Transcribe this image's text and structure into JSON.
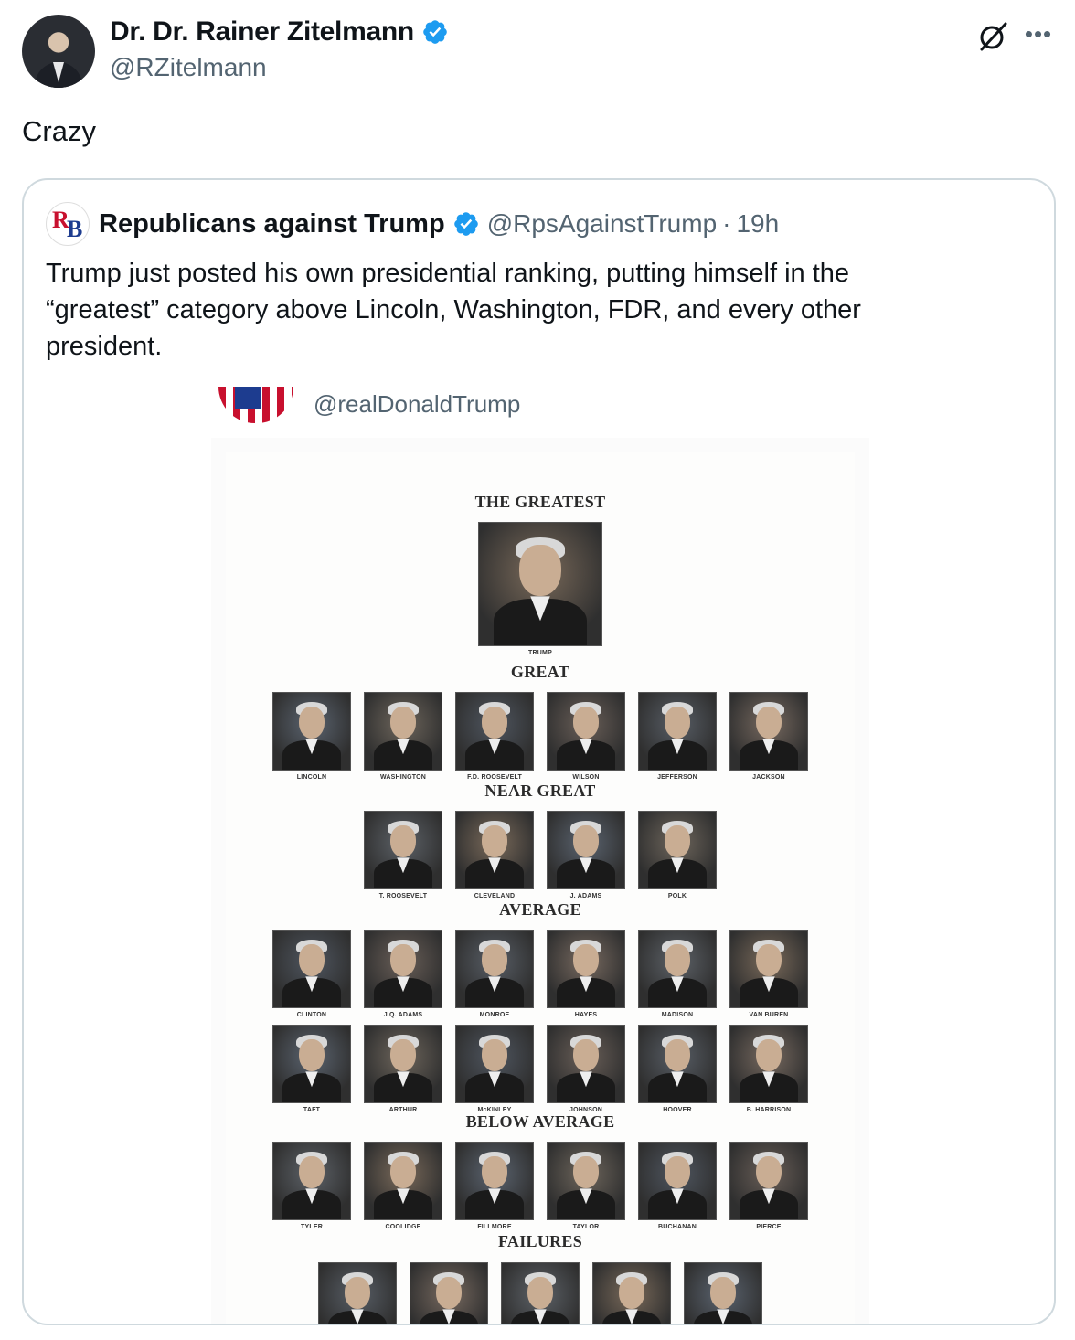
{
  "author": {
    "name": "Dr. Dr. Rainer Zitelmann",
    "handle": "@RZitelmann"
  },
  "tweet": {
    "text": "Crazy"
  },
  "quote": {
    "name": "Republicans against Trump",
    "handle": "@RpsAgainstTrump",
    "separator": "·",
    "time": "19h",
    "text": "Trump just posted his own presidential ranking, putting himself in the “greatest” category above Lincoln, Washington, FDR, and every other president."
  },
  "media": {
    "handle": "@realDonaldTrump",
    "sections": [
      {
        "title": "THE GREATEST",
        "rows": [
          [
            "TRUMP"
          ]
        ]
      },
      {
        "title": "GREAT",
        "rows": [
          [
            "LINCOLN",
            "WASHINGTON",
            "F.D. ROOSEVELT",
            "WILSON",
            "JEFFERSON",
            "JACKSON"
          ]
        ]
      },
      {
        "title": "NEAR GREAT",
        "rows": [
          [
            "T. ROOSEVELT",
            "CLEVELAND",
            "J. ADAMS",
            "POLK"
          ]
        ]
      },
      {
        "title": "AVERAGE",
        "rows": [
          [
            "CLINTON",
            "J.Q. ADAMS",
            "MONROE",
            "HAYES",
            "MADISON",
            "VAN BUREN"
          ],
          [
            "TAFT",
            "ARTHUR",
            "McKINLEY",
            "JOHNSON",
            "HOOVER",
            "B. HARRISON"
          ]
        ]
      },
      {
        "title": "BELOW AVERAGE",
        "rows": [
          [
            "TYLER",
            "COOLIDGE",
            "FILLMORE",
            "TAYLOR",
            "BUCHANAN",
            "PIERCE"
          ]
        ]
      },
      {
        "title": "FAILURES",
        "rows": [
          [
            "",
            "",
            "",
            "",
            ""
          ]
        ]
      }
    ]
  },
  "colors": {
    "text": "#0f1419",
    "secondary": "#536471",
    "verified": "#1d9bf0",
    "border": "#cfd9de"
  },
  "icons": [
    "verified-badge-icon",
    "grok-icon",
    "more-icon"
  ]
}
